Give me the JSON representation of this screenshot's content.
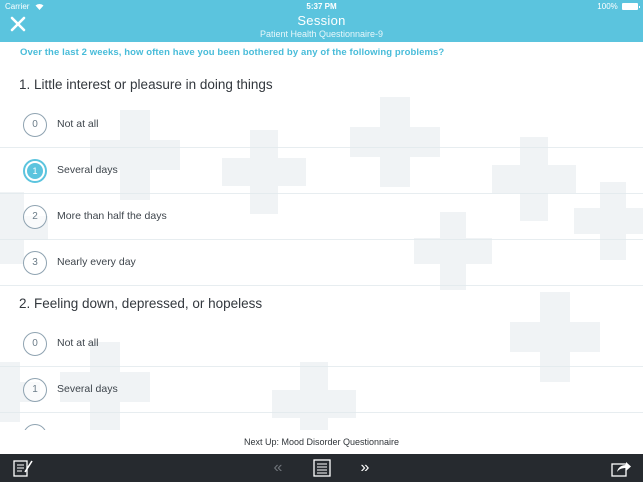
{
  "status_bar": {
    "carrier": "Carrier",
    "time": "5:37 PM",
    "battery": "100%"
  },
  "header": {
    "title": "Session",
    "subtitle": "Patient Health Questionnaire-9",
    "close_icon": "close-icon",
    "color": "#5bc4de"
  },
  "instruction": "Over the last 2 weeks, how often have you been bothered by any of the following problems?",
  "questions": [
    {
      "title": "1. Little interest or pleasure in doing things",
      "options": [
        {
          "number": "0",
          "label": "Not at all",
          "selected": false
        },
        {
          "number": "1",
          "label": "Several days",
          "selected": true
        },
        {
          "number": "2",
          "label": "More than half the days",
          "selected": false
        },
        {
          "number": "3",
          "label": "Nearly every day",
          "selected": false
        }
      ]
    },
    {
      "title": "2. Feeling down, depressed, or hopeless",
      "options": [
        {
          "number": "0",
          "label": "Not at all",
          "selected": false
        },
        {
          "number": "1",
          "label": "Several days",
          "selected": false
        }
      ]
    }
  ],
  "next_up": "Next Up: Mood Disorder Questionnaire",
  "toolbar": {
    "notes_icon": "notes-icon",
    "prev_label": "«",
    "list_icon": "list-icon",
    "next_label": "»",
    "share_icon": "share-icon"
  }
}
